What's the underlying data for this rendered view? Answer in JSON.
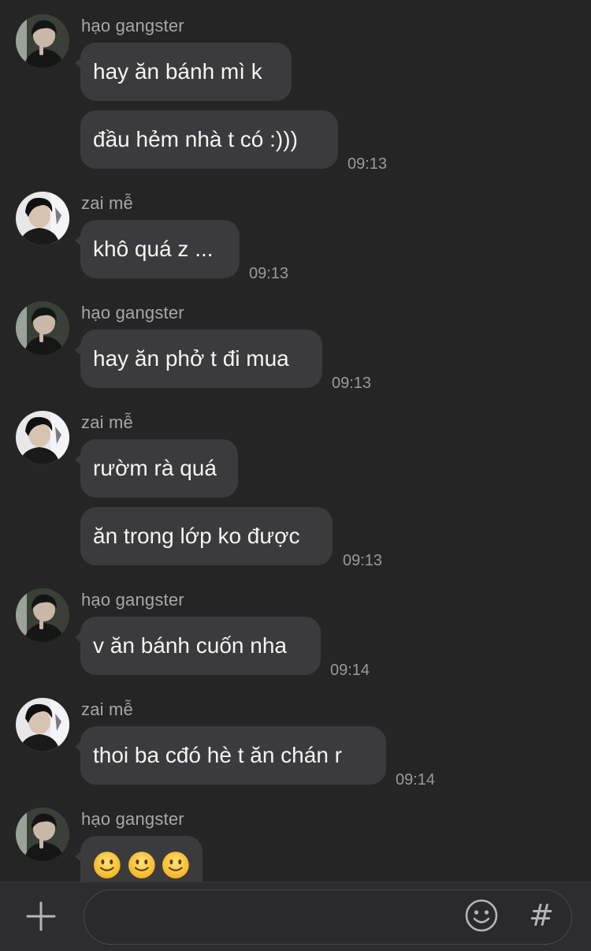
{
  "messages": [
    {
      "sender": "hạo gangster",
      "lines": [
        {
          "text": "hay ăn bánh mì k"
        },
        {
          "text": "đầu hẻm nhà t có :)))",
          "time": "09:13"
        }
      ]
    },
    {
      "sender": "zai mễ",
      "lines": [
        {
          "text": "khô quá z ...",
          "time": "09:13"
        }
      ]
    },
    {
      "sender": "hạo gangster",
      "lines": [
        {
          "text": "hay ăn phở t đi mua",
          "time": "09:13"
        }
      ]
    },
    {
      "sender": "zai mễ",
      "lines": [
        {
          "text": "rườm rà quá"
        },
        {
          "text": "ăn trong lớp ko được",
          "time": "09:13"
        }
      ]
    },
    {
      "sender": "hạo gangster",
      "lines": [
        {
          "text": "v ăn bánh cuốn nha",
          "time": "09:14"
        }
      ]
    },
    {
      "sender": "zai mễ",
      "lines": [
        {
          "text": "thoi ba cđó hè t ăn chán r",
          "time": "09:14"
        }
      ]
    },
    {
      "sender": "hạo gangster",
      "lines": [
        {
          "emoji": [
            "slightly-smiling-face",
            "slightly-smiling-face",
            "slightly-smiling-face"
          ]
        }
      ]
    }
  ],
  "composer": {
    "placeholder": "",
    "icons": {
      "plus": "plus-icon",
      "emoji": "smiley-face-icon",
      "hashtag": "#"
    }
  },
  "colors": {
    "background": "#252526",
    "bubble": "#3b3b3d",
    "sender_name": "#a7a7aa",
    "timestamp": "#9a9a9e",
    "composer": "#2d2d2f"
  }
}
